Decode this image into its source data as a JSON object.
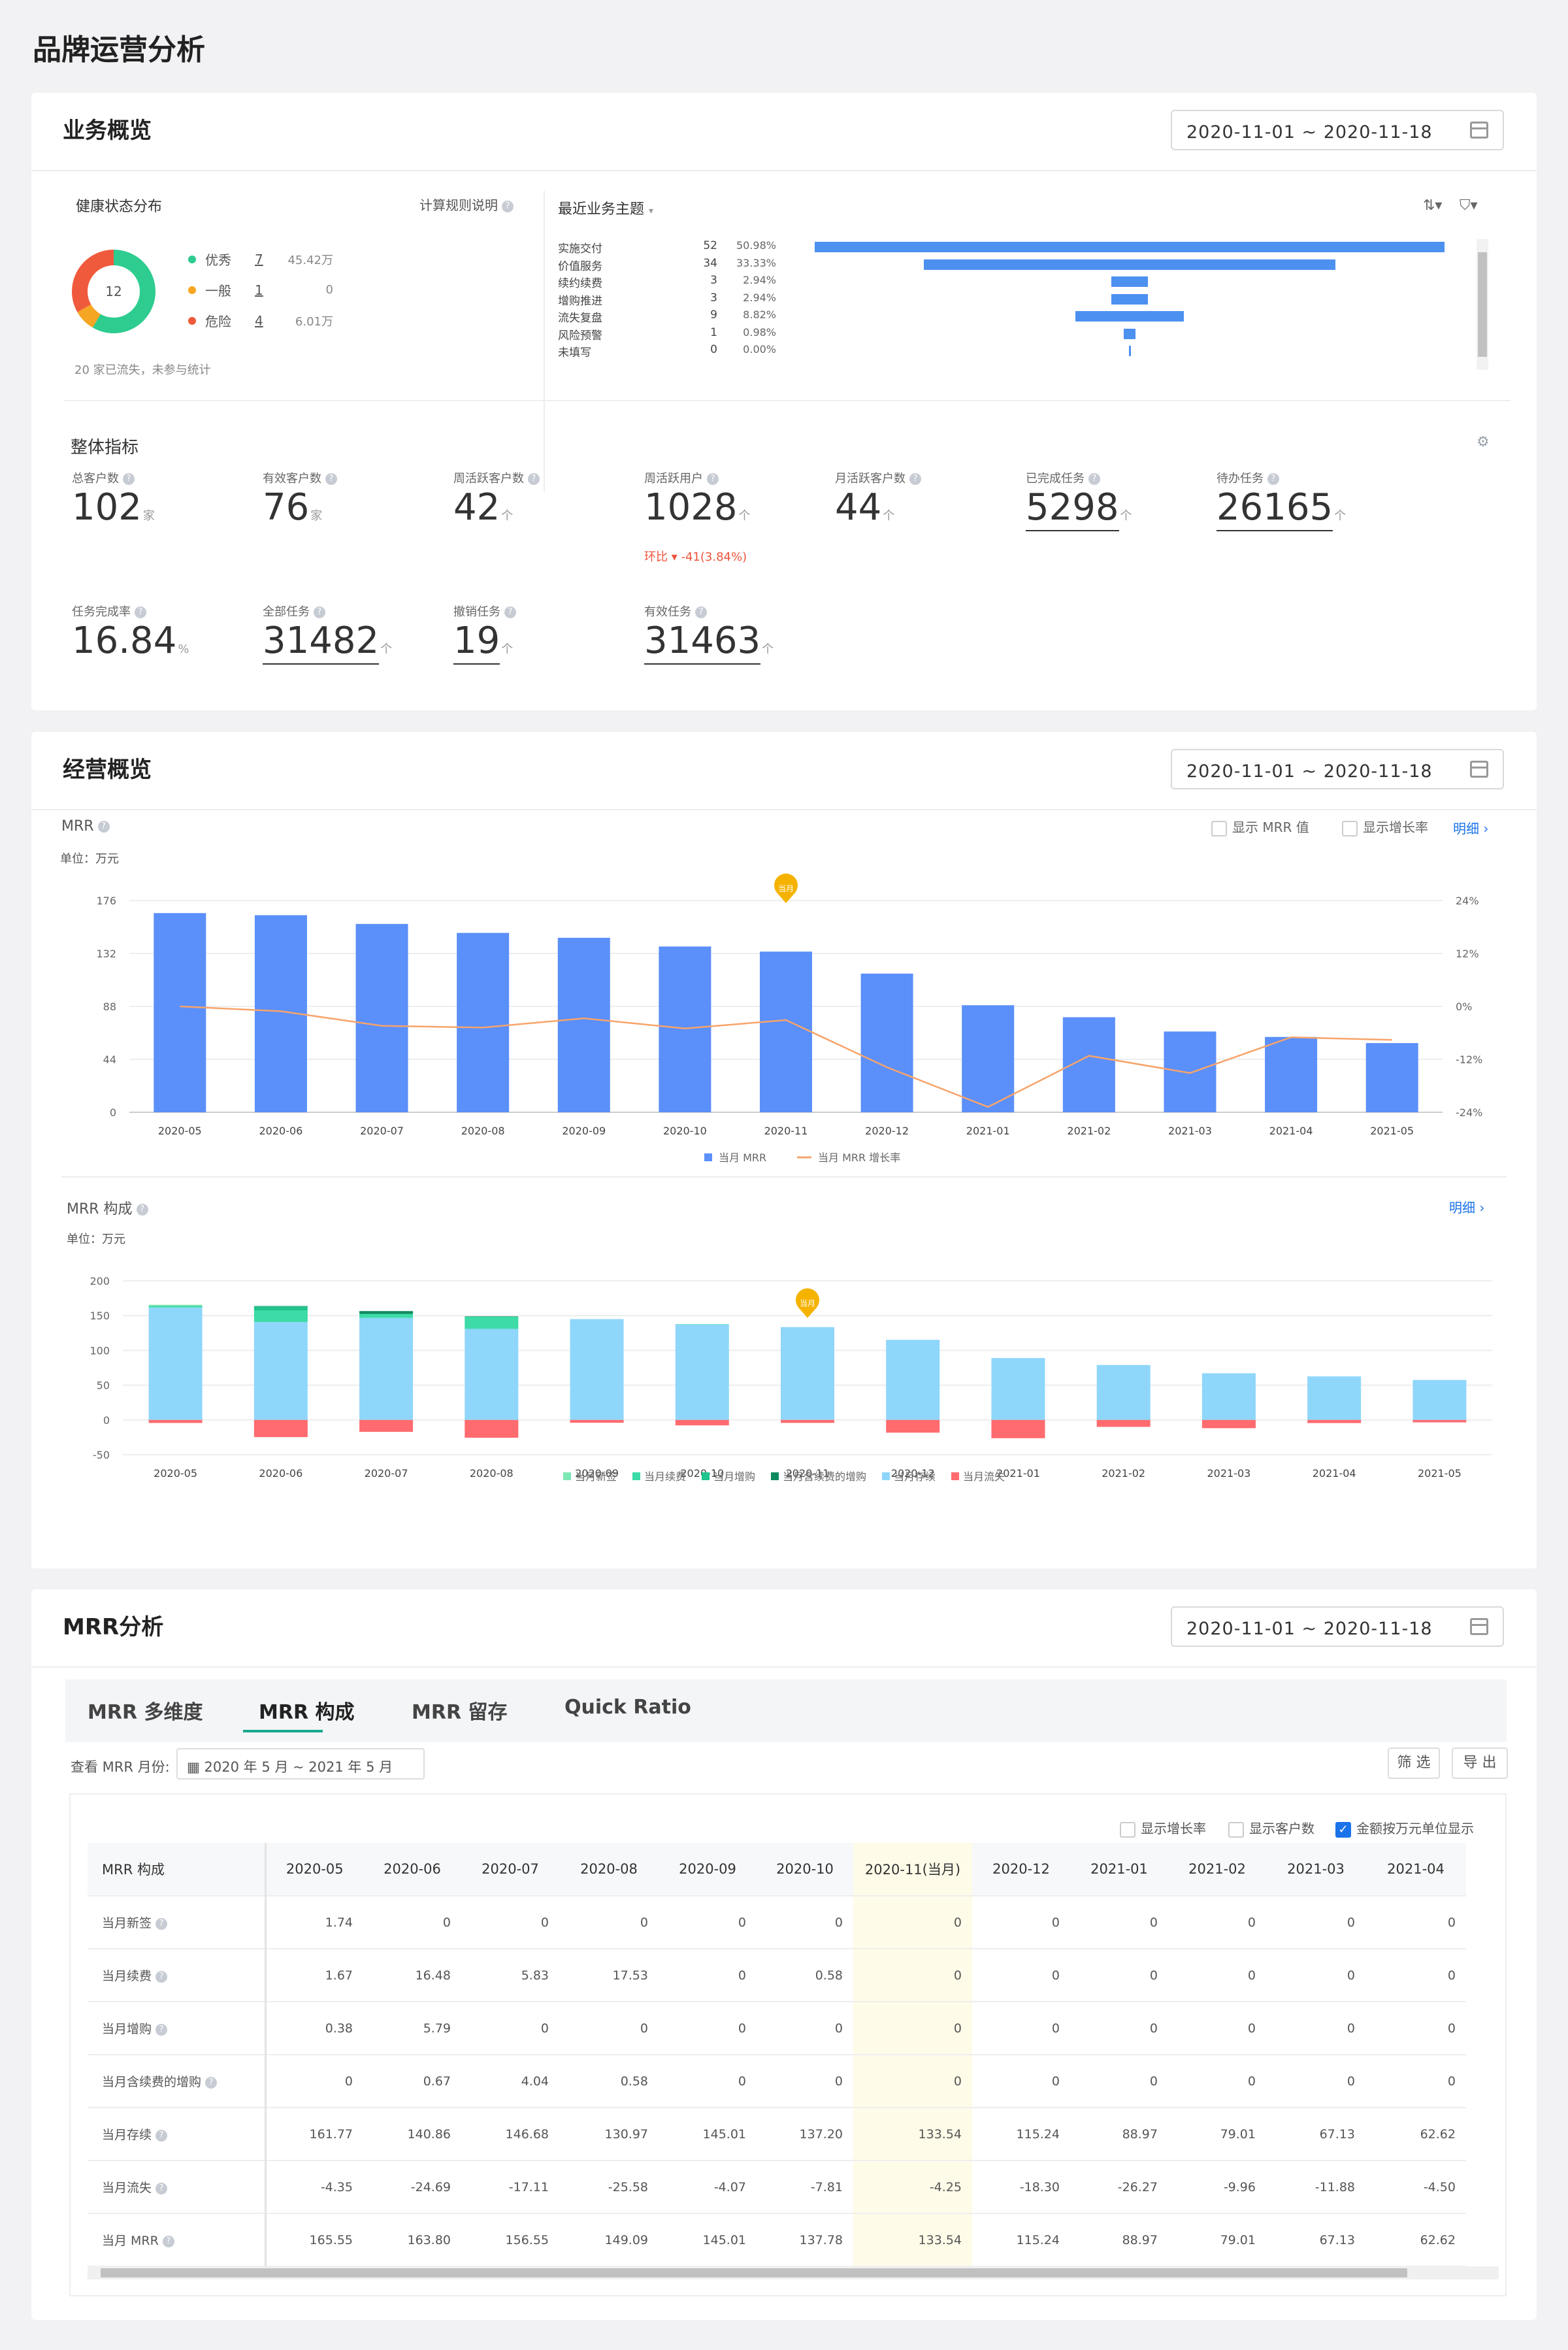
{
  "page": {
    "title": "品牌运营分析"
  },
  "business": {
    "title": "业务概览",
    "date_range": "2020-11-01 ~ 2020-11-18",
    "health": {
      "title": "健康状态分布",
      "rule_link": "计算规则说明",
      "center": "12",
      "items": [
        {
          "label": "优秀",
          "count": "7",
          "amount": "45.42万",
          "color": "#2ecc8f"
        },
        {
          "label": "一般",
          "count": "1",
          "amount": "0",
          "color": "#f5a623"
        },
        {
          "label": "危险",
          "count": "4",
          "amount": "6.01万",
          "color": "#f05a3c"
        }
      ],
      "footnote": "20 家已流失，未参与统计"
    },
    "topics": {
      "title": "最近业务主题",
      "rows": [
        {
          "name": "实施交付",
          "count": "52",
          "pct": "50.98%",
          "value": 52
        },
        {
          "name": "价值服务",
          "count": "34",
          "pct": "33.33%",
          "value": 34
        },
        {
          "name": "续约续费",
          "count": "3",
          "pct": "2.94%",
          "value": 3
        },
        {
          "name": "增购推进",
          "count": "3",
          "pct": "2.94%",
          "value": 3
        },
        {
          "name": "流失复盘",
          "count": "9",
          "pct": "8.82%",
          "value": 9
        },
        {
          "name": "风险预警",
          "count": "1",
          "pct": "0.98%",
          "value": 1
        },
        {
          "name": "未填写",
          "count": "0",
          "pct": "0.00%",
          "value": 0
        }
      ]
    },
    "metrics_title": "整体指标",
    "metrics": [
      {
        "label": "总客户数",
        "value": "102",
        "unit": "家"
      },
      {
        "label": "有效客户数",
        "value": "76",
        "unit": "家"
      },
      {
        "label": "周活跃客户数",
        "value": "42",
        "unit": "个"
      },
      {
        "label": "周活跃用户",
        "value": "1028",
        "unit": "个",
        "sub_label": "环比",
        "sub_value": "-41(3.84%)"
      },
      {
        "label": "月活跃客户数",
        "value": "44",
        "unit": "个"
      },
      {
        "label": "已完成任务",
        "value": "5298",
        "unit": "个"
      },
      {
        "label": "待办任务",
        "value": "26165",
        "unit": "个"
      },
      {
        "label": "任务完成率",
        "value": "16.84",
        "unit": "%"
      },
      {
        "label": "全部任务",
        "value": "31482",
        "unit": "个"
      },
      {
        "label": "撤销任务",
        "value": "19",
        "unit": "个"
      },
      {
        "label": "有效任务",
        "value": "31463",
        "unit": "个"
      }
    ]
  },
  "operations": {
    "title": "经营概览",
    "date_range": "2020-11-01 ~ 2020-11-18",
    "mrr_title": "MRR",
    "mrr_unit": "单位：万元",
    "show_mrr": "显示 MRR 值",
    "show_growth": "显示增长率",
    "detail": "明细",
    "comp_title": "MRR 构成",
    "comp_unit": "单位：万元",
    "comp_detail": "明细",
    "marker": "当月"
  },
  "chart_data": [
    {
      "type": "bar",
      "title": "MRR",
      "categories": [
        "2020-05",
        "2020-06",
        "2020-07",
        "2020-08",
        "2020-09",
        "2020-10",
        "2020-11",
        "2020-12",
        "2021-01",
        "2021-02",
        "2021-03",
        "2021-04",
        "2021-05"
      ],
      "ylim": [
        0,
        176
      ],
      "yticks": [
        "0",
        "44",
        "88",
        "132",
        "176"
      ],
      "y2lim": [
        -24,
        24
      ],
      "y2ticks": [
        "-24%",
        "-12%",
        "0%",
        "12%",
        "24%"
      ],
      "series": [
        {
          "name": "当月 MRR",
          "type": "bar",
          "color": "#5b8ff9",
          "values": [
            165.55,
            163.8,
            156.55,
            149.09,
            145.01,
            137.78,
            133.54,
            115.24,
            88.97,
            79.01,
            67.13,
            62.62,
            57.5
          ]
        },
        {
          "name": "当月 MRR 增长率",
          "type": "line",
          "color": "#f7a46b",
          "values": [
            0,
            -1.1,
            -4.4,
            -4.8,
            -2.7,
            -5.0,
            -3.1,
            -13.8,
            -22.8,
            -11.2,
            -15.1,
            -7.0,
            -7.6
          ]
        }
      ]
    },
    {
      "type": "bar",
      "title": "MRR 构成",
      "categories": [
        "2020-05",
        "2020-06",
        "2020-07",
        "2020-08",
        "2020-09",
        "2020-10",
        "2020-11",
        "2020-12",
        "2021-01",
        "2021-02",
        "2021-03",
        "2021-04",
        "2021-05"
      ],
      "ylim": [
        -50,
        200
      ],
      "yticks": [
        "-50",
        "0",
        "50",
        "100",
        "150",
        "200"
      ],
      "series": [
        {
          "name": "当月新签",
          "color": "#7ee8b5",
          "values": [
            1.74,
            0,
            0,
            0,
            0,
            0,
            0,
            0,
            0,
            0,
            0,
            0,
            0
          ]
        },
        {
          "name": "当月续费",
          "color": "#3ddba7",
          "values": [
            1.67,
            16.48,
            5.83,
            17.53,
            0,
            0.58,
            0,
            0,
            0,
            0,
            0,
            0,
            0
          ]
        },
        {
          "name": "当月增购",
          "color": "#1fc48e",
          "values": [
            0.38,
            5.79,
            0,
            0,
            0,
            0,
            0,
            0,
            0,
            0,
            0,
            0,
            0
          ]
        },
        {
          "name": "当月含续费的增购",
          "color": "#0f8a5e",
          "values": [
            0,
            0.67,
            4.04,
            0.58,
            0,
            0,
            0,
            0,
            0,
            0,
            0,
            0,
            0
          ]
        },
        {
          "name": "当月存续",
          "color": "#8fd6fb",
          "values": [
            161.77,
            140.86,
            146.68,
            130.97,
            145.01,
            137.2,
            133.54,
            115.24,
            88.97,
            79.01,
            67.13,
            62.62,
            57.5
          ]
        },
        {
          "name": "当月流失",
          "color": "#ff6b6f",
          "values": [
            -4.35,
            -24.69,
            -17.11,
            -25.58,
            -4.07,
            -7.81,
            -4.25,
            -18.3,
            -26.27,
            -9.96,
            -11.88,
            -4.5,
            -3.5
          ]
        }
      ]
    }
  ],
  "mrr": {
    "title": "MRR分析",
    "date_range": "2020-11-01 ~ 2020-11-18",
    "tabs": [
      "MRR 多维度",
      "MRR 构成",
      "MRR 留存",
      "Quick Ratio"
    ],
    "month_label": "查看 MRR 月份:",
    "month_range": "2020 年 5 月 ~ 2021 年 5 月",
    "filter_btn": "筛 选",
    "export_btn": "导 出",
    "opt_growth": "显示增长率",
    "opt_customers": "显示客户数",
    "opt_unit": "金额按万元单位显示",
    "table": {
      "headers": [
        "MRR 构成",
        "2020-05",
        "2020-06",
        "2020-07",
        "2020-08",
        "2020-09",
        "2020-10",
        "2020-11(当月)",
        "2020-12",
        "2021-01",
        "2021-02",
        "2021-03",
        "2021-04"
      ],
      "rows": [
        {
          "name": "当月新签",
          "cells": [
            "1.74",
            "0",
            "0",
            "0",
            "0",
            "0",
            "0",
            "0",
            "0",
            "0",
            "0",
            "0"
          ]
        },
        {
          "name": "当月续费",
          "cells": [
            "1.67",
            "16.48",
            "5.83",
            "17.53",
            "0",
            "0.58",
            "0",
            "0",
            "0",
            "0",
            "0",
            "0"
          ]
        },
        {
          "name": "当月增购",
          "cells": [
            "0.38",
            "5.79",
            "0",
            "0",
            "0",
            "0",
            "0",
            "0",
            "0",
            "0",
            "0",
            "0"
          ]
        },
        {
          "name": "当月含续费的增购",
          "cells": [
            "0",
            "0.67",
            "4.04",
            "0.58",
            "0",
            "0",
            "0",
            "0",
            "0",
            "0",
            "0",
            "0"
          ]
        },
        {
          "name": "当月存续",
          "cells": [
            "161.77",
            "140.86",
            "146.68",
            "130.97",
            "145.01",
            "137.20",
            "133.54",
            "115.24",
            "88.97",
            "79.01",
            "67.13",
            "62.62"
          ]
        },
        {
          "name": "当月流失",
          "cells": [
            "-4.35",
            "-24.69",
            "-17.11",
            "-25.58",
            "-4.07",
            "-7.81",
            "-4.25",
            "-18.30",
            "-26.27",
            "-9.96",
            "-11.88",
            "-4.50"
          ]
        },
        {
          "name": "当月 MRR",
          "cells": [
            "165.55",
            "163.80",
            "156.55",
            "149.09",
            "145.01",
            "137.78",
            "133.54",
            "115.24",
            "88.97",
            "79.01",
            "67.13",
            "62.62"
          ]
        }
      ]
    }
  }
}
